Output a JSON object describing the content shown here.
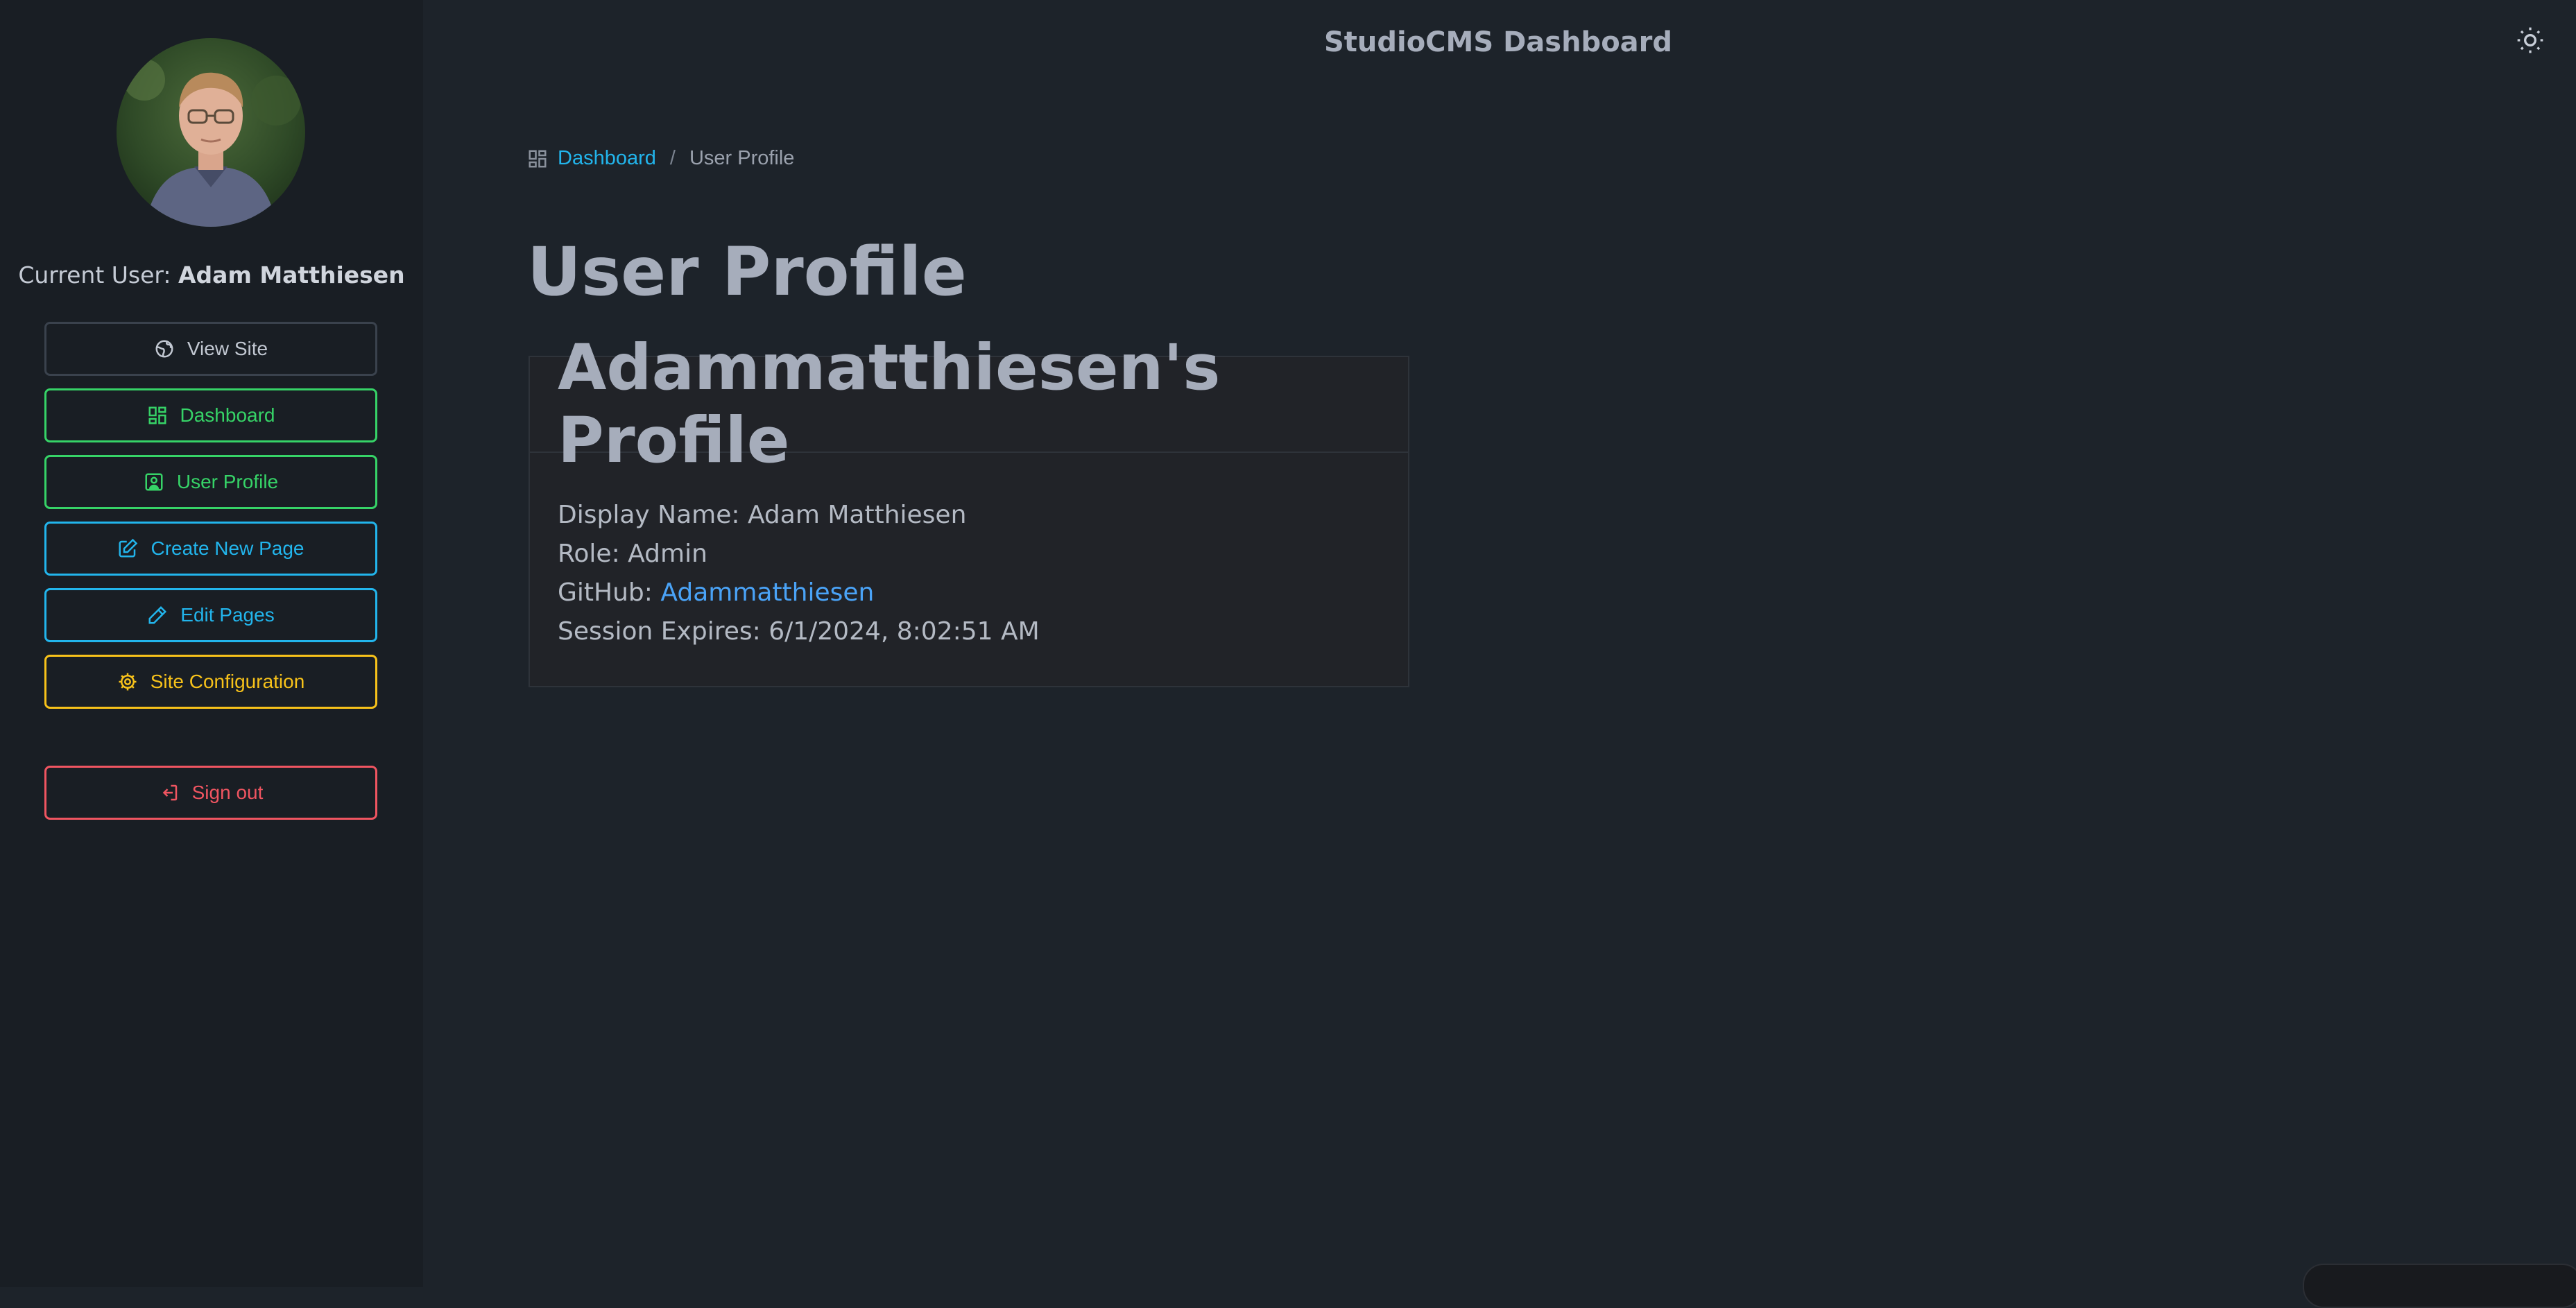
{
  "app": {
    "title": "StudioCMS Dashboard"
  },
  "sidebar": {
    "current_user_label": "Current User:",
    "current_user_name": "Adam Matthiesen",
    "buttons": [
      {
        "label": "View Site",
        "icon": "globe-icon"
      },
      {
        "label": "Dashboard",
        "icon": "dashboard-grid-icon"
      },
      {
        "label": "User Profile",
        "icon": "user-profile-icon"
      },
      {
        "label": "Create New Page",
        "icon": "edit-square-icon"
      },
      {
        "label": "Edit Pages",
        "icon": "pencil-icon"
      },
      {
        "label": "Site Configuration",
        "icon": "gear-icon"
      }
    ],
    "sign_out": {
      "label": "Sign out",
      "icon": "sign-out-icon"
    }
  },
  "breadcrumb": {
    "home": "Dashboard",
    "separator": "/",
    "current": "User Profile"
  },
  "main": {
    "page_title": "User Profile",
    "card": {
      "heading": "Adammatthiesen's Profile",
      "display_name_label": "Display Name:",
      "display_name": "Adam Matthiesen",
      "role_label": "Role:",
      "role": "Admin",
      "github_label": "GitHub:",
      "github": "Adammatthiesen",
      "session_label": "Session Expires:",
      "session_expires": "6/1/2024, 8:02:51 AM"
    }
  },
  "colors": {
    "background": "#1d232a",
    "sidebar": "#191e24",
    "success": "#36d367",
    "info": "#22b5ec",
    "warning": "#f7c21a",
    "error": "#f05561",
    "link": "#4aa3f7"
  }
}
